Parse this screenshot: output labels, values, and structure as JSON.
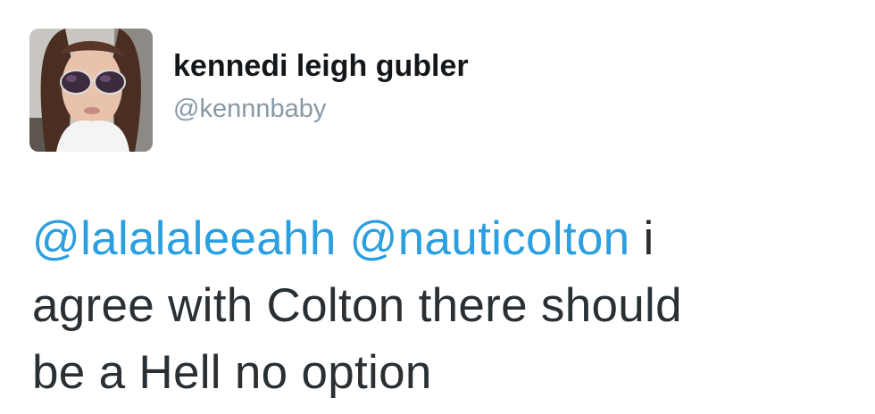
{
  "user": {
    "display_name": "kennedi leigh gubler",
    "handle": "@kennnbaby",
    "avatar_icon": "profile-photo"
  },
  "tweet": {
    "mention_1": "@lalalaleeahh",
    "mention_2": "@nauticolton",
    "line_1_rest": " i",
    "line_2": "agree with Colton there should",
    "line_3": "be a Hell no option"
  },
  "colors": {
    "mention": "#2b9fe0",
    "text": "#292f33",
    "handle": "#8899a6"
  }
}
